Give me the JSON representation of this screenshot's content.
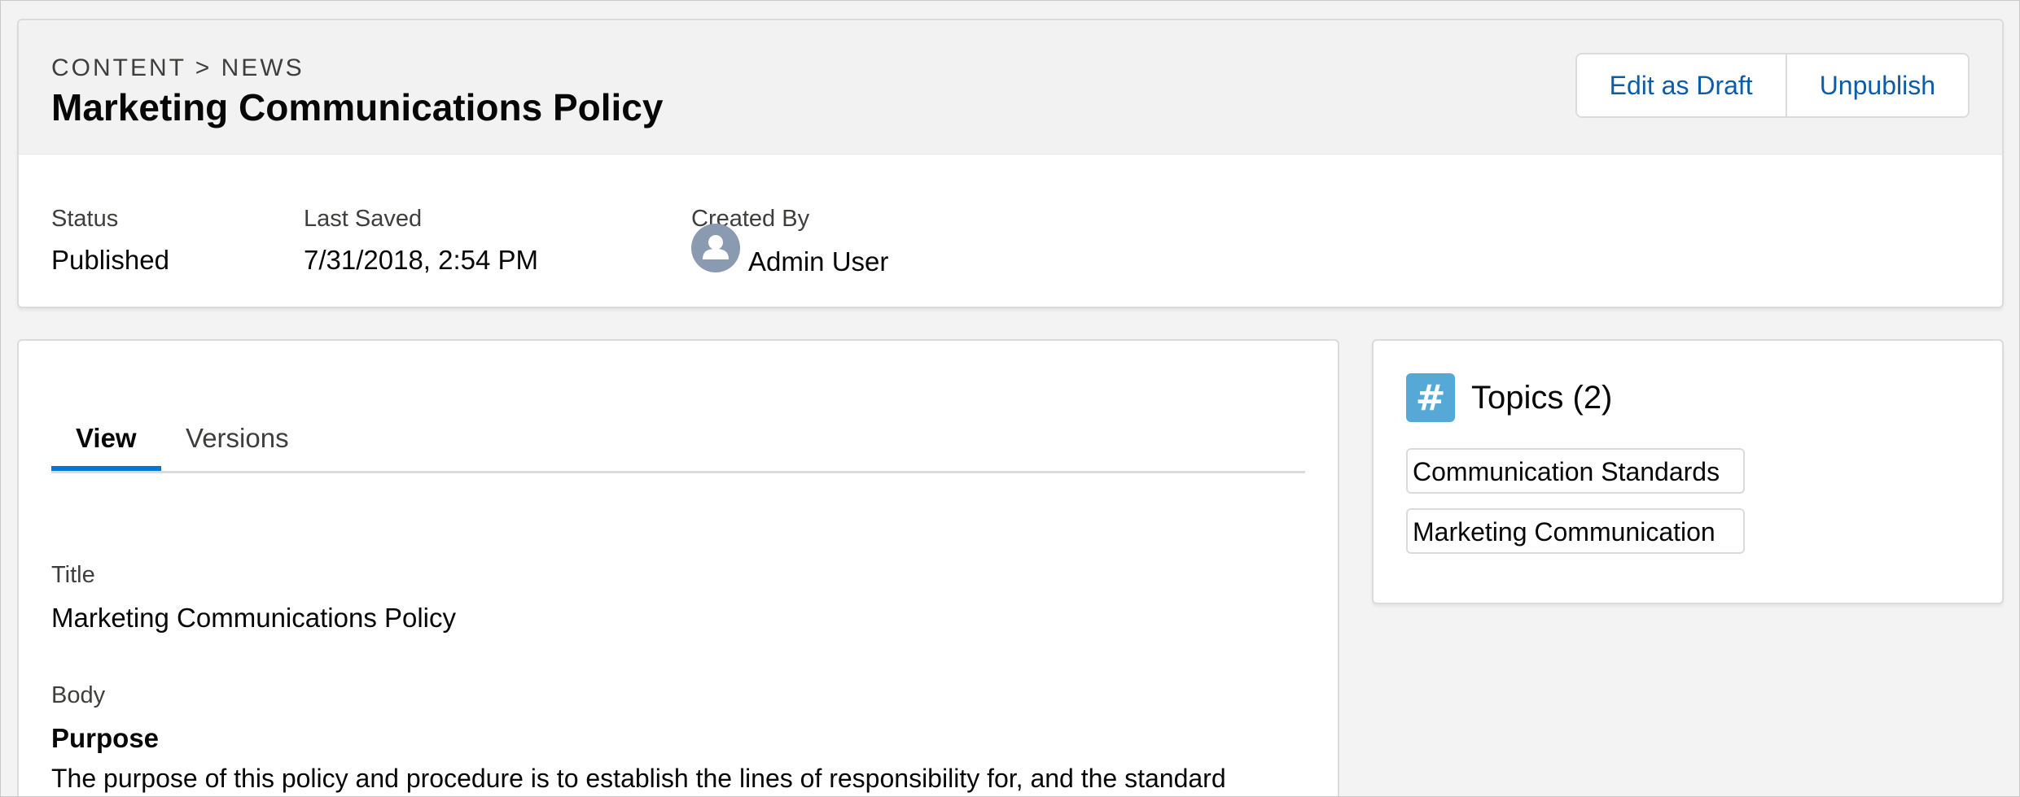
{
  "header": {
    "breadcrumb": "CONTENT > NEWS",
    "title": "Marketing Communications Policy",
    "actions": {
      "edit_as_draft": "Edit as Draft",
      "unpublish": "Unpublish"
    }
  },
  "details": {
    "status": {
      "label": "Status",
      "value": "Published"
    },
    "last_saved": {
      "label": "Last Saved",
      "value": "7/31/2018, 2:54 PM"
    },
    "created_by": {
      "label": "Created By",
      "value": "Admin User"
    }
  },
  "tabs": [
    {
      "label": "View",
      "active": true
    },
    {
      "label": "Versions",
      "active": false
    }
  ],
  "content": {
    "title_label": "Title",
    "title_value": "Marketing Communications Policy",
    "body_label": "Body",
    "body_heading": "Purpose",
    "body_text": "The purpose of this policy and procedure is to establish the lines of responsibility for, and the standard"
  },
  "topics": {
    "icon_glyph": "#",
    "title": "Topics (2)",
    "items": [
      "Communication Standards",
      "Marketing Communication"
    ]
  },
  "colors": {
    "accent": "#0176d3",
    "link": "#0b5cab",
    "topics_icon": "#56a8d6",
    "avatar": "#8a9ab1"
  }
}
